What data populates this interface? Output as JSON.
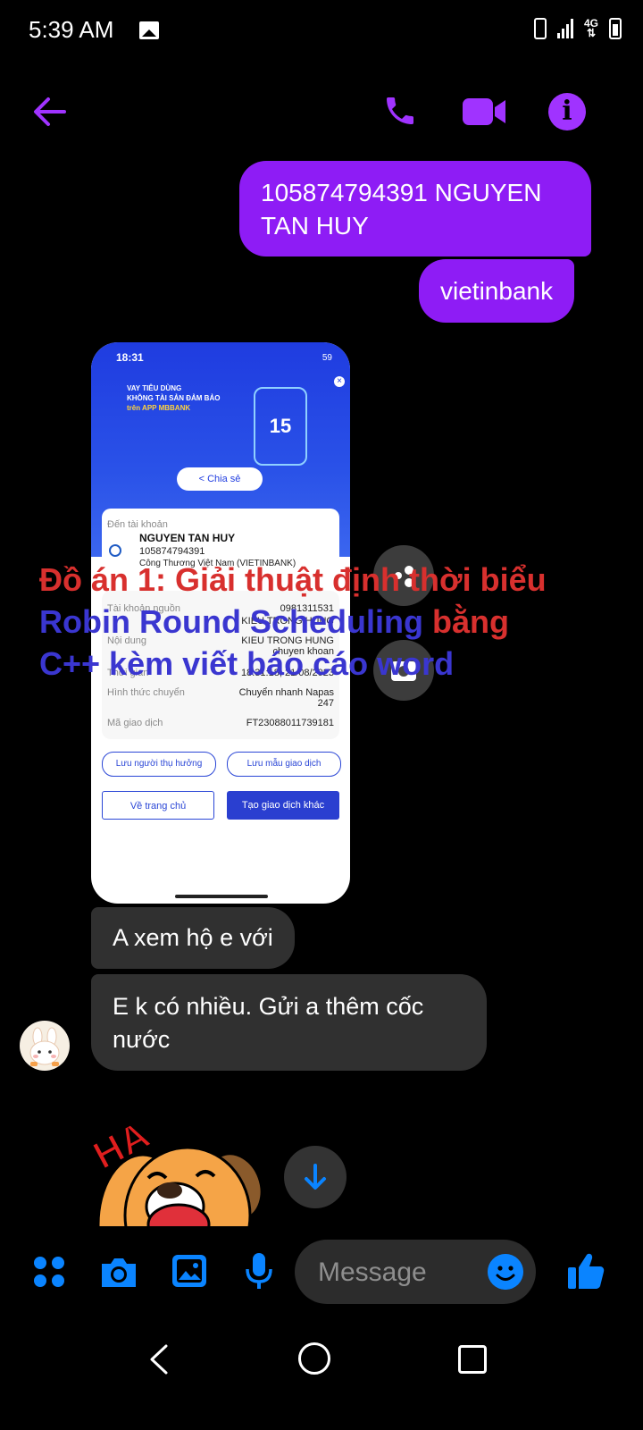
{
  "status_bar": {
    "time": "5:39 AM",
    "network": "4G",
    "icons": [
      "gallery-icon",
      "vibrate-icon",
      "signal-icon",
      "network-icon",
      "battery-icon"
    ]
  },
  "header": {
    "icons": [
      "back-arrow-icon",
      "phone-icon",
      "video-camera-icon",
      "info-icon"
    ],
    "accent_color": "#a033ff"
  },
  "messages": [
    {
      "direction": "outgoing",
      "text": "105874794391 NGUYEN TAN HUY"
    },
    {
      "direction": "outgoing",
      "text": "vietinbank"
    },
    {
      "direction": "incoming",
      "type": "image"
    },
    {
      "direction": "incoming",
      "text": "A xem hộ e với"
    },
    {
      "direction": "incoming",
      "text": "E k có nhiều. Gửi a thêm cốc nước"
    }
  ],
  "shared_image": {
    "time": "18:31",
    "battery": "59",
    "banner_line1": "VAY TIÊU DÙNG",
    "banner_line2": "KHÔNG TÀI SẢN ĐẢM BẢO",
    "banner_line3": "trên APP MBBANK",
    "banner_number": "15",
    "share_label": "Chia sẻ",
    "to_account_label": "Đến tài khoản",
    "recipient_name": "NGUYEN TAN HUY",
    "recipient_account": "105874794391",
    "recipient_bank": "Công Thương Việt Nam (VIETINBANK)",
    "rows": [
      {
        "label": "Tài khoản nguồn",
        "value": "0981311531"
      },
      {
        "label": "",
        "value": "KIEU TRONG HUNG"
      },
      {
        "label": "Nội dung",
        "value": "KIEU TRONG HUNG chuyen khoan"
      },
      {
        "label": "Thời gian",
        "value": "18:31:18, 21/08/2023"
      },
      {
        "label": "Hình thức chuyển",
        "value": "Chuyển nhanh Napas 247"
      },
      {
        "label": "Mã giao dịch",
        "value": "FT23088011739181"
      }
    ],
    "save_recipient": "Lưu người thụ hưởng",
    "save_template": "Lưu mẫu giao dịch",
    "home_button": "Về trang chủ",
    "new_transaction_button": "Tạo giao dịch khác"
  },
  "watermark": {
    "line1": "Đồ án 1: Giải thuật định thời biểu",
    "line2_blue": "Robin Round Scheduling",
    "line2_red": " bằng",
    "line3_blue": "C++ kèm viết báo cáo word"
  },
  "sticker": {
    "text": "HA"
  },
  "composer": {
    "placeholder": "Message",
    "icons": [
      "apps-icon",
      "camera-icon",
      "gallery-icon",
      "mic-icon",
      "emoji-icon",
      "thumbs-up-icon"
    ]
  },
  "nav": {
    "icons": [
      "nav-back-icon",
      "nav-home-icon",
      "nav-recents-icon"
    ]
  }
}
